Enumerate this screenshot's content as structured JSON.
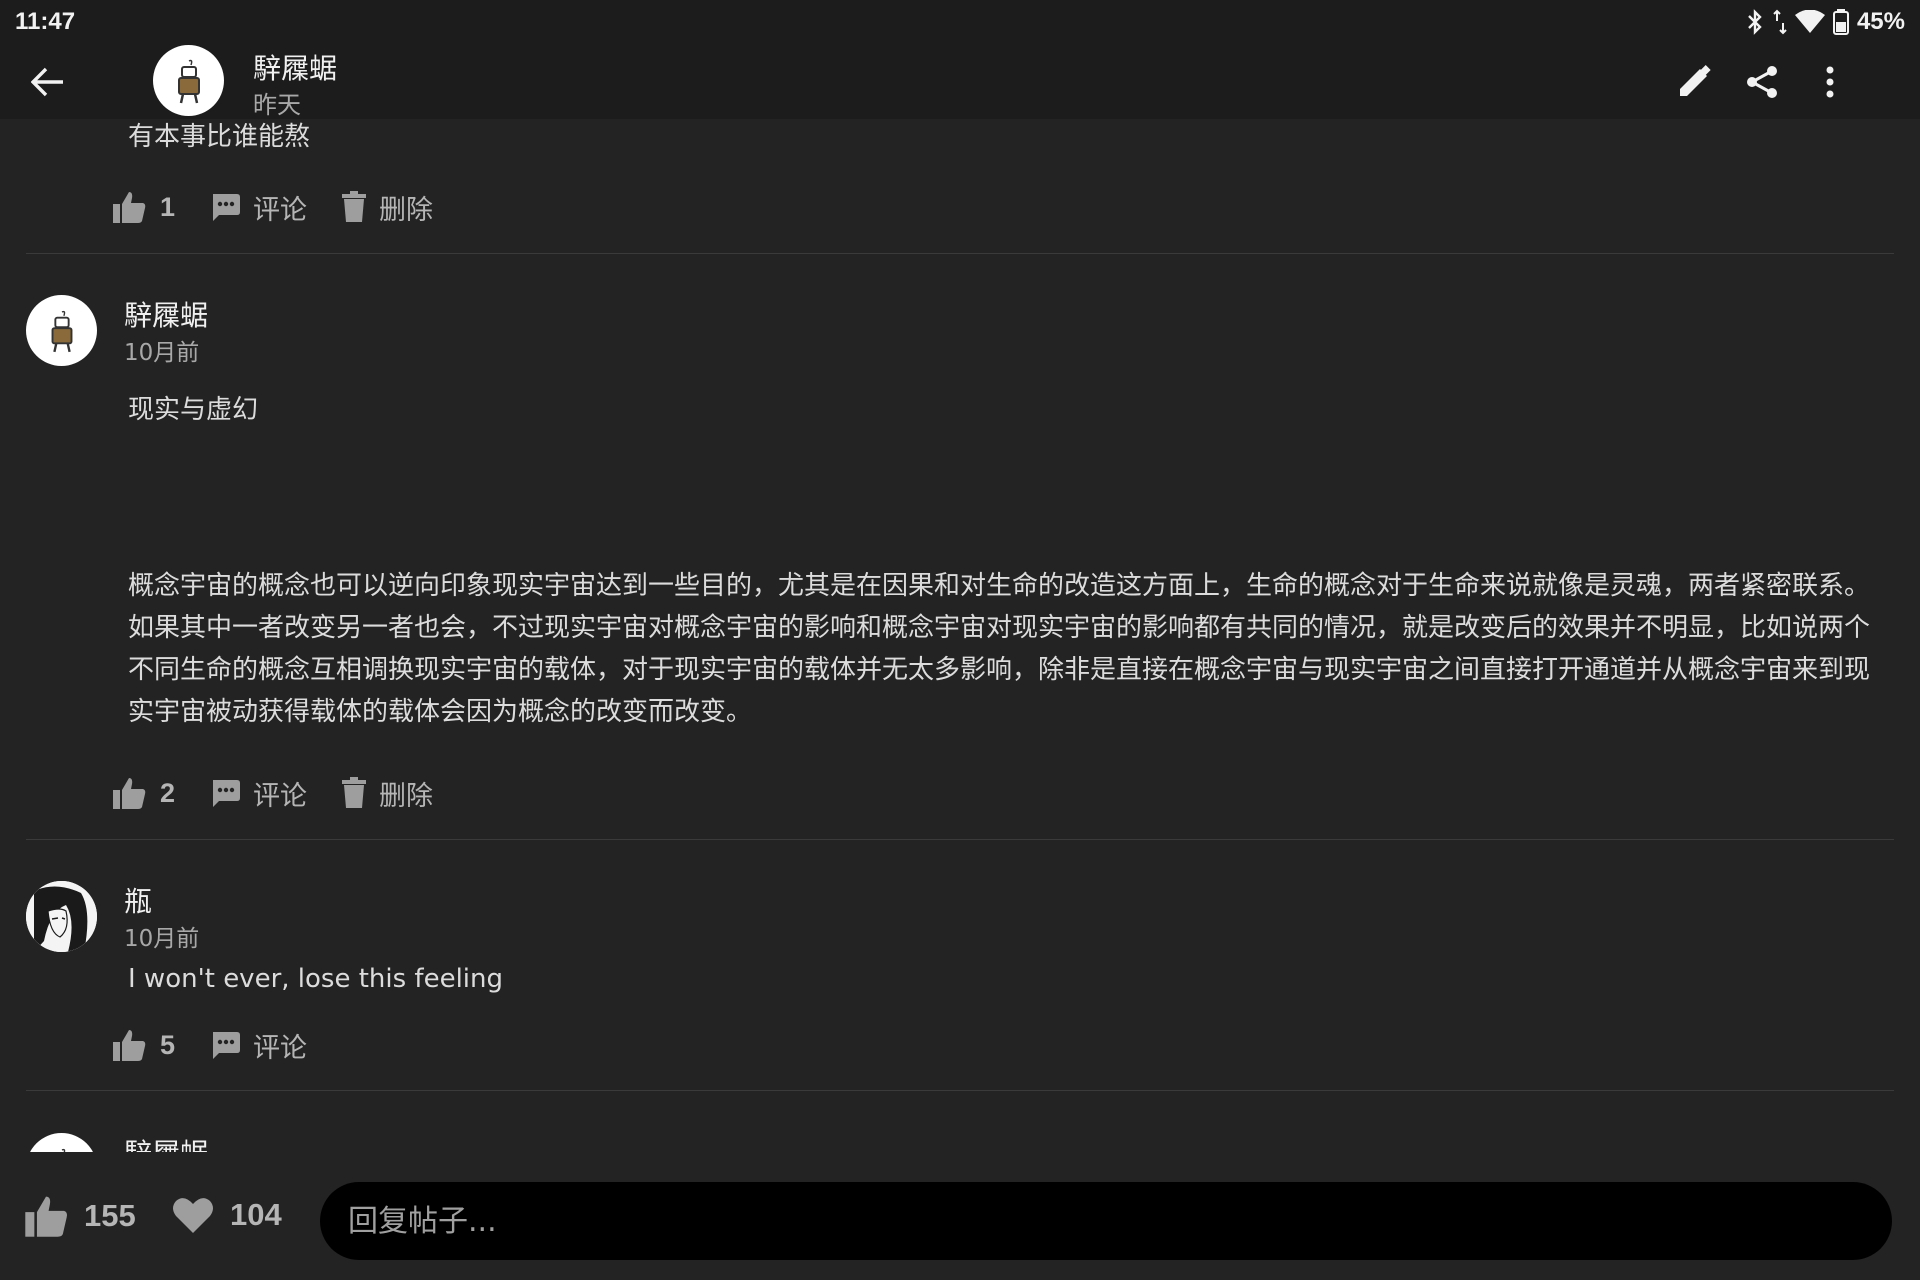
{
  "status": {
    "time": "11:47",
    "battery": "45%"
  },
  "header": {
    "title": "騂屧蜛",
    "subtitle": "昨天"
  },
  "labels": {
    "comment": "评论",
    "delete": "删除"
  },
  "posts": [
    {
      "text": "有本事比谁能熬",
      "likes": "1"
    },
    {
      "author": "騂屧蜛",
      "time": "10月前",
      "title": "现实与虚幻",
      "body": " 概念宇宙的概念也可以逆向印象现实宇宙达到一些目的，尤其是在因果和对生命的改造这方面上，生命的概念对于生命来说就像是灵魂，两者紧密联系。如果其中一者改变另一者也会，不过现实宇宙对概念宇宙的影响和概念宇宙对现实宇宙的影响都有共同的情况，就是改变后的效果并不明显，比如说两个不同生命的概念互相调换现实宇宙的载体，对于现实宇宙的载体并无太多影响，除非是直接在概念宇宙与现实宇宙之间直接打开通道并从概念宇宙来到现实宇宙被动获得载体的载体会因为概念的改变而改变。",
      "likes": "2"
    },
    {
      "author": "瓶",
      "time": "10月前",
      "text": "I won't ever, lose this feeling",
      "likes": "5"
    },
    {
      "author": "騂屧蜛"
    }
  ],
  "footer": {
    "likes": "155",
    "hearts": "104",
    "reply_placeholder": "回复帖子..."
  },
  "colors": {
    "background": "#232323",
    "bar": "#1c1c1c",
    "input": "#000000",
    "icon": "#9e9e9e"
  }
}
